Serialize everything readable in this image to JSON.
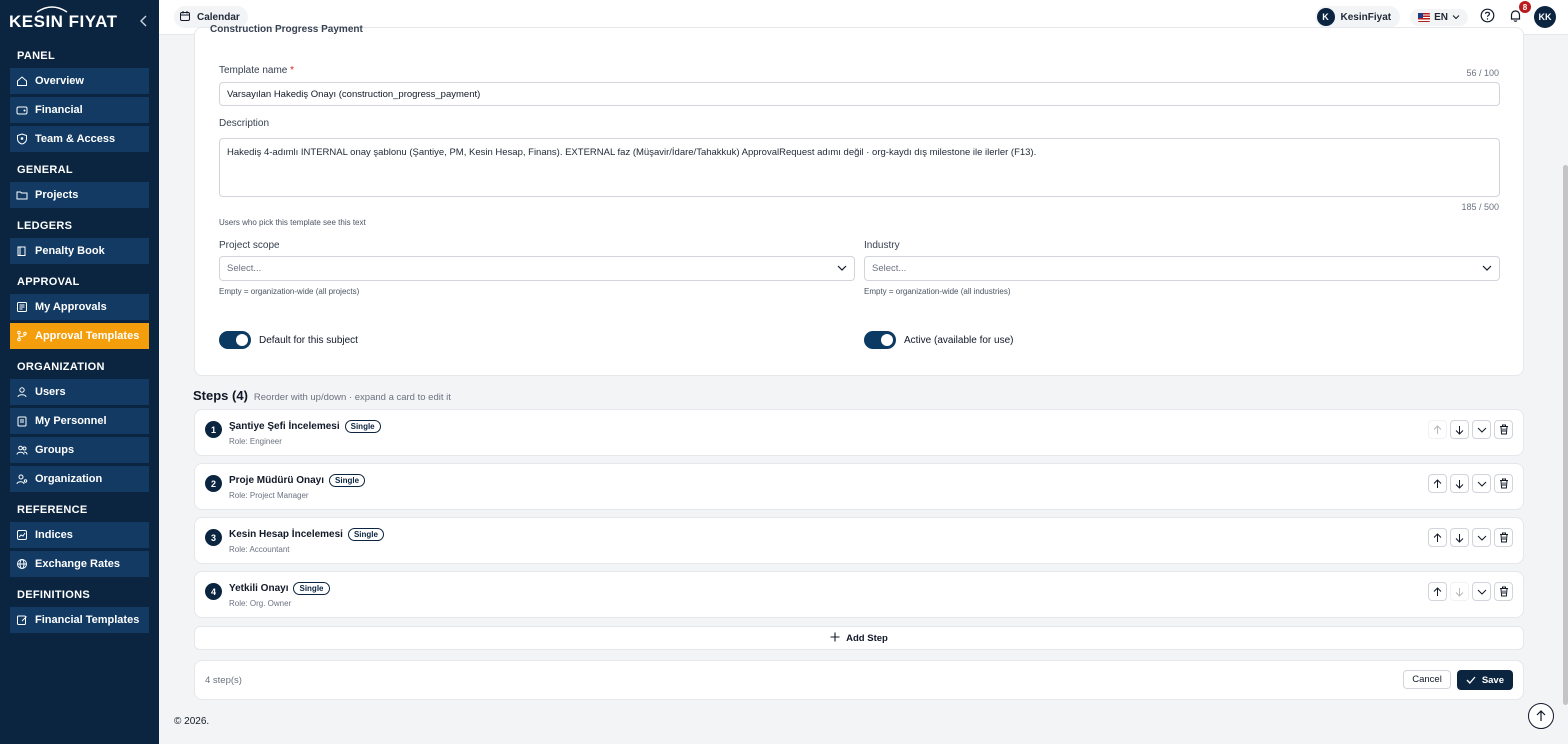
{
  "brand": {
    "logo_text": "KESIN FIYAT"
  },
  "sidebar": {
    "sections": [
      {
        "title": "PANEL",
        "items": [
          {
            "label": "Overview",
            "icon": "home-icon"
          },
          {
            "label": "Financial",
            "icon": "wallet-icon"
          },
          {
            "label": "Team & Access",
            "icon": "shield-user-icon"
          }
        ]
      },
      {
        "title": "GENERAL",
        "items": [
          {
            "label": "Projects",
            "icon": "folder-icon"
          }
        ]
      },
      {
        "title": "LEDGERS",
        "items": [
          {
            "label": "Penalty Book",
            "icon": "book-icon"
          }
        ]
      },
      {
        "title": "APPROVAL",
        "items": [
          {
            "label": "My Approvals",
            "icon": "inbox-icon"
          },
          {
            "label": "Approval Templates",
            "icon": "git-branch-icon",
            "active": true
          }
        ]
      },
      {
        "title": "ORGANIZATION",
        "items": [
          {
            "label": "Users",
            "icon": "user-icon"
          },
          {
            "label": "My Personnel",
            "icon": "clipboard-icon"
          },
          {
            "label": "Groups",
            "icon": "users-icon"
          },
          {
            "label": "Organization",
            "icon": "user-cog-icon"
          }
        ]
      },
      {
        "title": "REFERENCE",
        "items": [
          {
            "label": "Indices",
            "icon": "chart-icon"
          },
          {
            "label": "Exchange Rates",
            "icon": "globe-icon"
          }
        ]
      },
      {
        "title": "DEFINITIONS",
        "items": [
          {
            "label": "Financial Templates",
            "icon": "edit-doc-icon"
          }
        ]
      }
    ]
  },
  "topbar": {
    "calendar_label": "Calendar",
    "user_initial": "K",
    "user_name": "KesinFiyat",
    "language": "EN",
    "notification_count": "8",
    "avatar_initials": "KK"
  },
  "form": {
    "clipped_title": "Construction Progress Payment",
    "template_name_label": "Template name",
    "required_mark": "*",
    "template_name_counter": "56 / 100",
    "template_name_value": "Varsayılan Hakediş Onayı (construction_progress_payment)",
    "description_label": "Description",
    "description_value": "Hakediş 4-adımlı INTERNAL onay şablonu (Şantiye, PM, Kesin Hesap, Finans). EXTERNAL faz (Müşavir/İdare/Tahakkuk) ApprovalRequest adımı değil · org-kaydı dış milestone ile ilerler (F13).",
    "description_counter": "185 / 500",
    "description_hint": "Users who pick this template see this text",
    "project_scope_label": "Project scope",
    "project_scope_placeholder": "Select...",
    "project_scope_hint": "Empty = organization-wide (all projects)",
    "industry_label": "Industry",
    "industry_placeholder": "Select...",
    "industry_hint": "Empty = organization-wide (all industries)",
    "default_toggle_label": "Default for this subject",
    "active_toggle_label": "Active (available for use)"
  },
  "steps": {
    "title": "Steps (4)",
    "subtitle": "Reorder with up/down · expand a card to edit it",
    "items": [
      {
        "num": "1",
        "title": "Şantiye Şefi İncelemesi",
        "type": "Single",
        "role": "Role: Engineer"
      },
      {
        "num": "2",
        "title": "Proje Müdürü Onayı",
        "type": "Single",
        "role": "Role: Project Manager"
      },
      {
        "num": "3",
        "title": "Kesin Hesap İncelemesi",
        "type": "Single",
        "role": "Role: Accountant"
      },
      {
        "num": "4",
        "title": "Yetkili Onayı",
        "type": "Single",
        "role": "Role: Org. Owner"
      }
    ],
    "add_label": "Add Step"
  },
  "footer": {
    "step_count": "4 step(s)",
    "cancel_label": "Cancel",
    "save_label": "Save",
    "copyright": "© 2026."
  },
  "colors": {
    "sidebar_bg": "#0b2540",
    "nav_item_bg": "#123a63",
    "active_item": "#f59e0b",
    "primary": "#0b2540",
    "notification": "#b91c1c"
  }
}
